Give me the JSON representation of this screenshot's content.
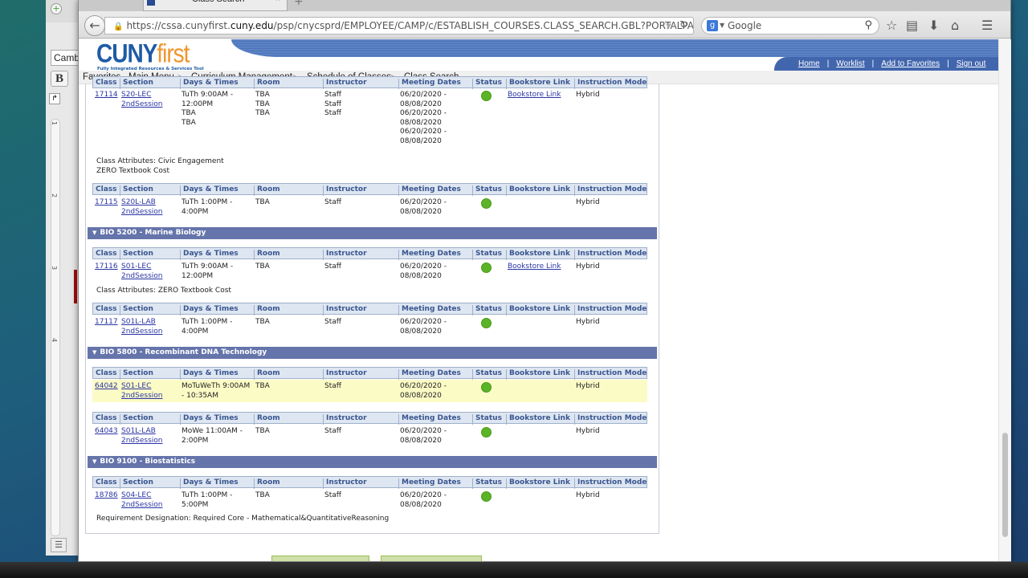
{
  "background_app": {
    "font_name": "Camb",
    "bold_label": "B",
    "ruler_marks": [
      "1",
      "2",
      "3",
      "4"
    ]
  },
  "browser": {
    "tab_title": "Class Search",
    "tab_close": "×",
    "new_tab": "+",
    "url_prefix": "https://cssa.cunyfirst.",
    "url_domain": "cuny.edu",
    "url_suffix": "/psp/cnycsprd/EMPLOYEE/CAMP/c/ESTABLISH_COURSES.CLASS_SEARCH.GBL?PORTALPARAM_PTCN",
    "search_placeholder": "Google",
    "icons": [
      "back-icon",
      "lock-icon",
      "reload-icon",
      "google-icon",
      "search-icon",
      "bookmark-star-icon",
      "reading-list-icon",
      "download-icon",
      "home-icon",
      "menu-icon"
    ]
  },
  "portal": {
    "logo_cuny": "CUNY",
    "logo_first": "first",
    "logo_tagline": "Fully Integrated Resources & Services Tool",
    "top_links": [
      "Home",
      "Worklist",
      "Add to Favorites",
      "Sign out"
    ],
    "breadcrumb": [
      "Favorites",
      "Main Menu",
      "Curriculum Management",
      "Schedule of Classes",
      "Class Search"
    ]
  },
  "columns": [
    "Class",
    "Section",
    "Days & Times",
    "Room",
    "Instructor",
    "Meeting Dates",
    "Status",
    "Bookstore Link",
    "Instruction Mode"
  ],
  "status_color": "#5bb326",
  "courses": [
    {
      "title": null,
      "sections": [
        {
          "class": "17114",
          "section": "S20-LEC",
          "session": "2ndSession",
          "days_times": [
            "TuTh 9:00AM -",
            "12:00PM",
            "TBA",
            "TBA"
          ],
          "room": [
            "TBA",
            "TBA",
            "TBA"
          ],
          "instructor": [
            "Staff",
            "Staff",
            "Staff"
          ],
          "dates": [
            "06/20/2020 -",
            "08/08/2020",
            "06/20/2020 -",
            "08/08/2020",
            "06/20/2020 -",
            "08/08/2020"
          ],
          "status": "Open",
          "bookstore": "Bookstore Link",
          "mode": "Hybrid",
          "attributes": [
            "Class Attributes: Civic Engagement",
            "ZERO Textbook Cost"
          ]
        },
        {
          "class": "17115",
          "section": "S20L-LAB",
          "session": "2ndSession",
          "days_times": [
            "TuTh 1:00PM -",
            "4:00PM"
          ],
          "room": [
            "TBA"
          ],
          "instructor": [
            "Staff"
          ],
          "dates": [
            "06/20/2020 -",
            "08/08/2020"
          ],
          "status": "Open",
          "bookstore": "",
          "mode": "Hybrid"
        }
      ]
    },
    {
      "title": "BIO 5200 - Marine Biology",
      "sections": [
        {
          "class": "17116",
          "section": "S01-LEC",
          "session": "2ndSession",
          "days_times": [
            "TuTh 9:00AM -",
            "12:00PM"
          ],
          "room": [
            "TBA"
          ],
          "instructor": [
            "Staff"
          ],
          "dates": [
            "06/20/2020 -",
            "08/08/2020"
          ],
          "status": "Open",
          "bookstore": "Bookstore Link",
          "mode": "Hybrid",
          "attributes": [
            "Class Attributes: ZERO Textbook Cost"
          ]
        },
        {
          "class": "17117",
          "section": "S01L-LAB",
          "session": "2ndSession",
          "days_times": [
            "TuTh 1:00PM -",
            "4:00PM"
          ],
          "room": [
            "TBA"
          ],
          "instructor": [
            "Staff"
          ],
          "dates": [
            "06/20/2020 -",
            "08/08/2020"
          ],
          "status": "Open",
          "bookstore": "",
          "mode": "Hybrid"
        }
      ]
    },
    {
      "title": "BIO 5800 - Recombinant DNA Technology",
      "sections": [
        {
          "class": "64042",
          "section": "S01-LEC",
          "session": "2ndSession",
          "days_times": [
            "MoTuWeTh 9:00AM",
            "- 10:35AM"
          ],
          "room": [
            "TBA"
          ],
          "instructor": [
            "Staff"
          ],
          "dates": [
            "06/20/2020 -",
            "08/08/2020"
          ],
          "status": "Open",
          "bookstore": "",
          "mode": "Hybrid",
          "highlighted": true
        },
        {
          "class": "64043",
          "section": "S01L-LAB",
          "session": "2ndSession",
          "days_times": [
            "MoWe 11:00AM -",
            "2:00PM"
          ],
          "room": [
            "TBA"
          ],
          "instructor": [
            "Staff"
          ],
          "dates": [
            "06/20/2020 -",
            "08/08/2020"
          ],
          "status": "Open",
          "bookstore": "",
          "mode": "Hybrid"
        }
      ]
    },
    {
      "title": "BIO 9100 - Biostatistics",
      "sections": [
        {
          "class": "18786",
          "section": "S04-LEC",
          "session": "2ndSession",
          "days_times": [
            "TuTh 1:00PM -",
            "5:00PM"
          ],
          "room": [
            "TBA"
          ],
          "instructor": [
            "Staff"
          ],
          "dates": [
            "06/20/2020 -",
            "08/08/2020"
          ],
          "status": "Open",
          "bookstore": "",
          "mode": "Hybrid",
          "attributes": [
            "Requirement Designation: Required Core - Mathematical&QuantitativeReasoning"
          ]
        }
      ]
    }
  ]
}
